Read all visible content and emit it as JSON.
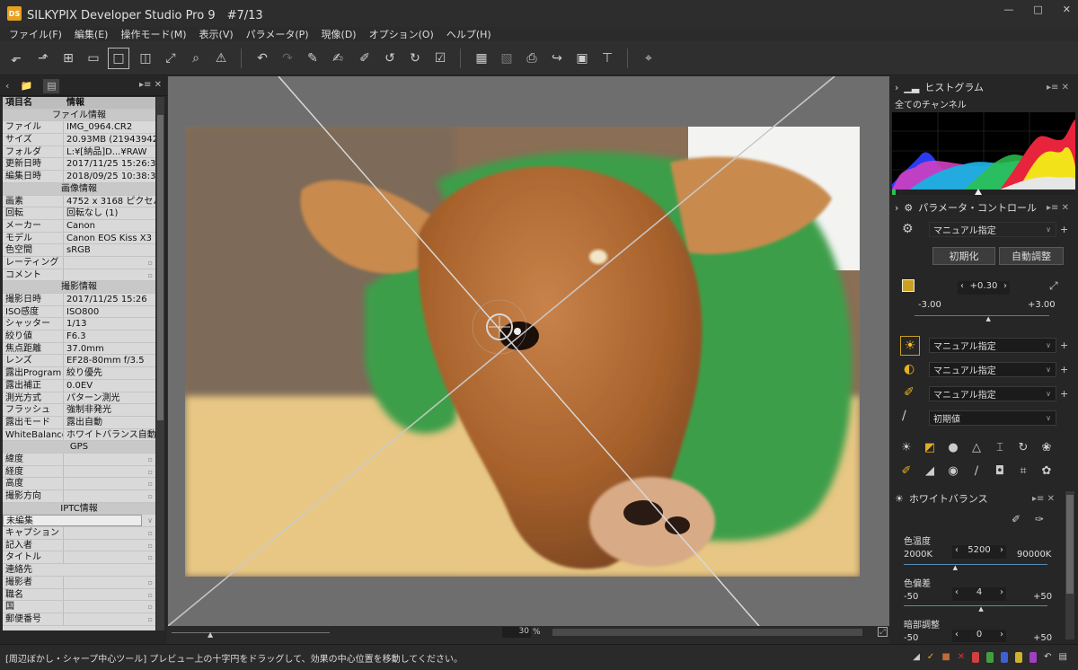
{
  "window": {
    "title": "SILKYPIX Developer Studio Pro 9　#7/13",
    "icon_label": "DS",
    "controls": [
      "—",
      "□",
      "✕"
    ]
  },
  "menu": [
    "ファイル(F)",
    "編集(E)",
    "操作モード(M)",
    "表示(V)",
    "パラメータ(P)",
    "現像(D)",
    "オプション(O)",
    "ヘルプ(H)"
  ],
  "info_table": {
    "headers": [
      "項目名",
      "情報"
    ],
    "rows": [
      {
        "sec": "ファイル情報"
      },
      {
        "k": "ファイル",
        "v": "IMG_0964.CR2"
      },
      {
        "k": "サイズ",
        "v": "20.93MB (21943942"
      },
      {
        "k": "フォルダ",
        "v": "L:¥[納品]D...¥RAW"
      },
      {
        "k": "更新日時",
        "v": "2017/11/25 15:26:3"
      },
      {
        "k": "編集日時",
        "v": "2018/09/25 10:38:3"
      },
      {
        "sec": "画像情報"
      },
      {
        "k": "画素",
        "v": "4752 x 3168 ピクセル"
      },
      {
        "k": "回転",
        "v": "回転なし (1)"
      },
      {
        "k": "メーカー",
        "v": "Canon"
      },
      {
        "k": "モデル",
        "v": "Canon EOS Kiss X3"
      },
      {
        "k": "色空間",
        "v": "sRGB"
      },
      {
        "k": "レーティング",
        "v": "",
        "dot": true
      },
      {
        "k": "コメント",
        "v": "",
        "dot": true
      },
      {
        "sec": "撮影情報"
      },
      {
        "k": "撮影日時",
        "v": "2017/11/25 15:26"
      },
      {
        "k": "ISO感度",
        "v": "ISO800"
      },
      {
        "k": "シャッター",
        "v": "1/13"
      },
      {
        "k": "絞り値",
        "v": "F6.3"
      },
      {
        "k": "焦点距離",
        "v": "37.0mm"
      },
      {
        "k": "レンズ",
        "v": "EF28-80mm f/3.5"
      },
      {
        "k": "露出Program",
        "v": "絞り優先"
      },
      {
        "k": "露出補正",
        "v": "0.0EV"
      },
      {
        "k": "測光方式",
        "v": "パターン測光"
      },
      {
        "k": "フラッシュ",
        "v": "強制非発光"
      },
      {
        "k": "露出モード",
        "v": "露出自動"
      },
      {
        "k": "WhiteBalance",
        "v": "ホワイトバランス自動"
      },
      {
        "sec": "GPS"
      },
      {
        "k": "緯度",
        "v": "",
        "dot": true
      },
      {
        "k": "経度",
        "v": "",
        "dot": true
      },
      {
        "k": "高度",
        "v": "",
        "dot": true
      },
      {
        "k": "撮影方向",
        "v": "",
        "dot": true
      },
      {
        "sec": "IPTC情報"
      },
      {
        "k": "未編集",
        "v": "",
        "select": true
      },
      {
        "k": "キャプション",
        "v": "",
        "dot": true
      },
      {
        "k": "記入者",
        "v": "",
        "dot": true
      },
      {
        "k": "タイトル",
        "v": "",
        "dot": true
      },
      {
        "sec2": "連絡先"
      },
      {
        "k": "撮影者",
        "v": "",
        "dot": true
      },
      {
        "k": "職名",
        "v": "",
        "dot": true
      },
      {
        "k": "国",
        "v": "",
        "dot": true
      },
      {
        "k": "郵便番号",
        "v": "",
        "dot": true
      }
    ]
  },
  "preview": {
    "zoom": "30",
    "zoom_unit": "%"
  },
  "histogram": {
    "title": "ヒストグラム",
    "channel": "全てのチャンネル"
  },
  "params": {
    "title": "パラメータ・コントロール",
    "preset": "マニュアル指定",
    "init_btn": "初期化",
    "auto_btn": "自動調整",
    "exposure_value": "+0.30",
    "exposure_min": "-3.00",
    "exposure_max": "+3.00",
    "exposure_level": 0.55,
    "dd1": "マニュアル指定",
    "dd2": "マニュアル指定",
    "dd3": "マニュアル指定",
    "dd4": "初期値"
  },
  "wb": {
    "title": "ホワイトバランス",
    "temp_label": "色温度",
    "temp_min": "2000K",
    "temp_value": "5200",
    "temp_max": "90000K",
    "temp_level": 0.36,
    "tint_label": "色偏差",
    "tint_min": "-50",
    "tint_value": "4",
    "tint_max": "+50",
    "tint_level": 0.54,
    "dark_label": "暗部調整",
    "dark_min": "-50",
    "dark_value": "0",
    "dark_max": "+50"
  },
  "status": {
    "text": "[周辺ぼかし・シャープ中心ツール] プレビュー上の十字円をドラッグして、効果の中心位置を移動してください。"
  },
  "colors": {
    "accent": "#e8a020",
    "histogram_red": "#e8243c",
    "histogram_green": "#2cc24a",
    "histogram_blue": "#2a3cf0",
    "histogram_yellow": "#f2e21a",
    "histogram_cyan": "#1ab0e0",
    "histogram_magenta": "#d040c0"
  }
}
